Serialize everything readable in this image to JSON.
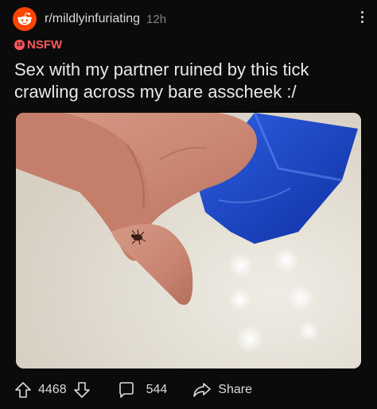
{
  "post": {
    "subreddit": "r/mildlyinfuriating",
    "age": "12h",
    "nsfw_badge": "18",
    "nsfw_label": "NSFW",
    "title": "Sex with my partner ruined by this tick crawling across my bare asscheek :/"
  },
  "actions": {
    "upvotes": "4468",
    "comments": "544",
    "share_label": "Share"
  },
  "icons": {
    "avatar": "reddit-snoo-icon",
    "menu": "more-vertical-icon",
    "upvote": "arrow-up-icon",
    "downvote": "arrow-down-icon",
    "comment": "comment-bubble-icon",
    "share": "share-arrow-icon"
  },
  "colors": {
    "background": "#0b0b0b",
    "nsfw": "#ff585b",
    "avatar": "#ff4500",
    "text": "#d7dadc",
    "muted": "#818384"
  }
}
